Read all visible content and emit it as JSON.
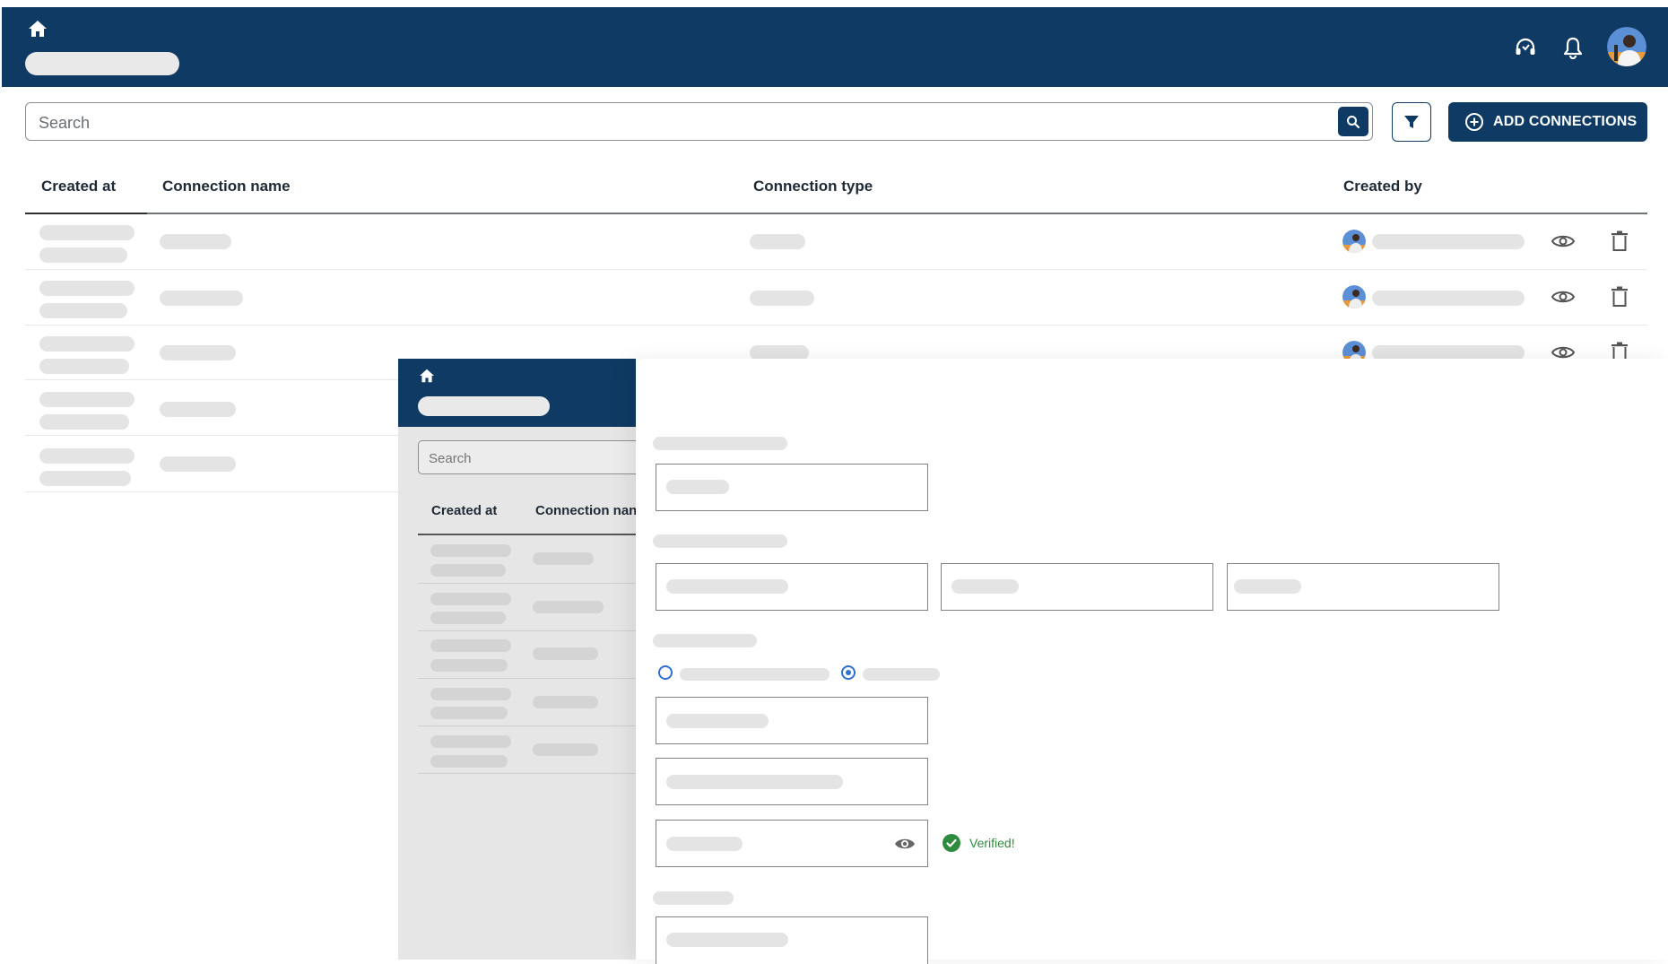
{
  "header": {
    "home_icon": "home-icon",
    "support_icon": "headset-icon",
    "notification_icon": "bell-icon",
    "avatar": "user-avatar"
  },
  "toolbar": {
    "search_placeholder": "Search",
    "search_button_icon": "search-icon",
    "filter_icon": "filter-icon",
    "add_button_label": "ADD CONNECTIONS",
    "add_button_icon": "plus-circle-icon"
  },
  "table": {
    "columns": [
      "Created at",
      "Connection name",
      "Connection type",
      "Created by"
    ],
    "row_count": 5,
    "row_actions": [
      "view-icon",
      "delete-icon"
    ]
  },
  "background_page": {
    "search_placeholder": "Search",
    "columns": [
      "Created at",
      "Connection nan"
    ]
  },
  "form": {
    "password_toggle_icon": "eye-icon",
    "verified_icon": "check-circle-icon",
    "verified_text": "Verified!"
  },
  "colors": {
    "brand_navy": "#0f3a63",
    "accent_blue": "#2f6fcf",
    "success_green": "#2e8b3e",
    "skeleton": "#e4e4e4"
  }
}
